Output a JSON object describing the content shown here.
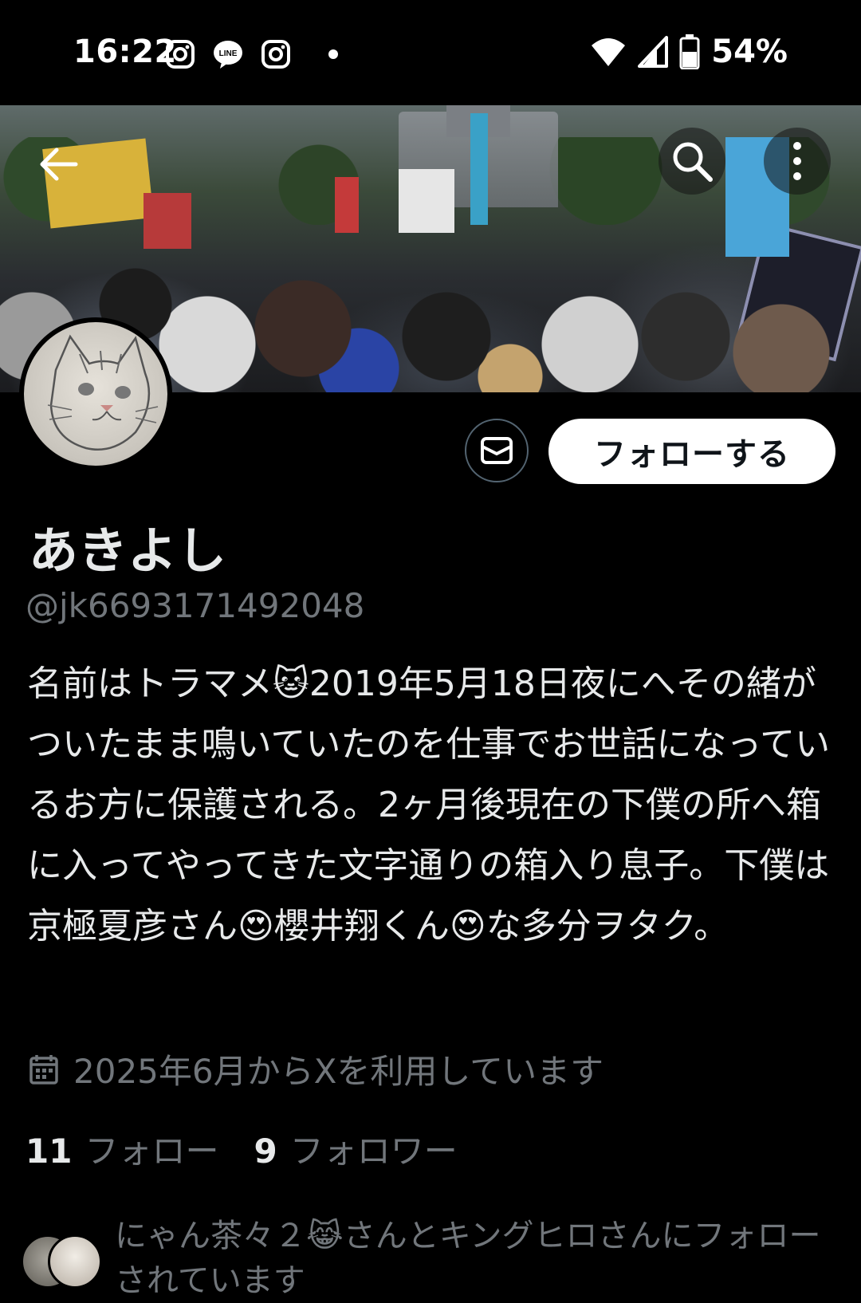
{
  "status_bar": {
    "time": "16:22",
    "battery": "54%",
    "icons": [
      "instagram-icon",
      "line-icon",
      "instagram-icon",
      "notification-dot",
      "wifi-icon",
      "signal-icon",
      "battery-icon"
    ],
    "line_label": "LINE"
  },
  "header": {
    "back_icon": "arrow-left-icon",
    "search_icon": "search-icon",
    "more_icon": "more-vertical-icon"
  },
  "profile": {
    "display_name": "あきよし",
    "handle": "@jk6693171492048",
    "bio": "名前はトラマメ🐱2019年5月18日夜にへその緒がついたまま鳴いていたのを仕事でお世話になっているお方に保護される。2ヶ月後現在の下僕の所へ箱に入ってやってきた文字通りの箱入り息子。下僕は京極夏彦さん😍櫻井翔くん😍な多分ヲタク。",
    "joined": "2025年6月からXを利用しています",
    "following_count": "11",
    "following_label": "フォロー",
    "followers_count": "9",
    "followers_label": "フォロワー",
    "followed_by": "にゃん茶々２😹さんとキングヒロさんにフォローされています"
  },
  "actions": {
    "follow_label": "フォローする",
    "message_icon": "mail-icon"
  },
  "colors": {
    "background": "#000000",
    "text_primary": "#e7e9ea",
    "text_secondary": "#71767b",
    "follow_button_bg": "#ffffff"
  }
}
